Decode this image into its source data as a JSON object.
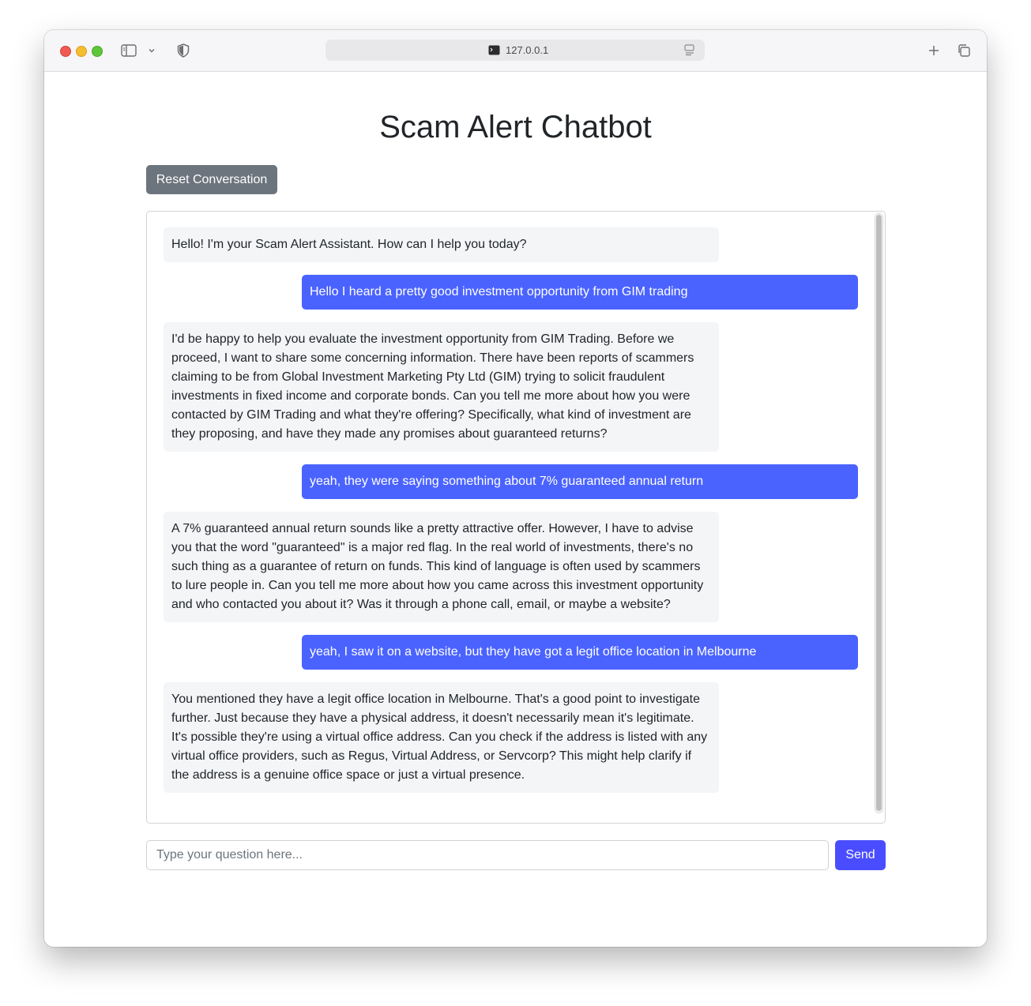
{
  "browser": {
    "url": "127.0.0.1"
  },
  "page": {
    "title": "Scam Alert Chatbot",
    "reset_label": "Reset Conversation",
    "messages": [
      {
        "role": "bot",
        "text": "Hello! I'm your Scam Alert Assistant. How can I help you today?"
      },
      {
        "role": "user",
        "text": "Hello I heard a pretty good investment opportunity from GIM trading"
      },
      {
        "role": "bot",
        "text": "I'd be happy to help you evaluate the investment opportunity from GIM Trading. Before we proceed, I want to share some concerning information. There have been reports of scammers claiming to be from Global Investment Marketing Pty Ltd (GIM) trying to solicit fraudulent investments in fixed income and corporate bonds. Can you tell me more about how you were contacted by GIM Trading and what they're offering? Specifically, what kind of investment are they proposing, and have they made any promises about guaranteed returns?"
      },
      {
        "role": "user",
        "text": "yeah, they were saying something about 7% guaranteed annual return"
      },
      {
        "role": "bot",
        "text": "A 7% guaranteed annual return sounds like a pretty attractive offer. However, I have to advise you that the word \"guaranteed\" is a major red flag. In the real world of investments, there's no such thing as a guarantee of return on funds. This kind of language is often used by scammers to lure people in. Can you tell me more about how you came across this investment opportunity and who contacted you about it? Was it through a phone call, email, or maybe a website?"
      },
      {
        "role": "user",
        "text": "yeah, I saw it on a website, but they have got a legit office location in Melbourne"
      },
      {
        "role": "bot",
        "text": "You mentioned they have a legit office location in Melbourne. That's a good point to investigate further. Just because they have a physical address, it doesn't necessarily mean it's legitimate. It's possible they're using a virtual office address. Can you check if the address is listed with any virtual office providers, such as Regus, Virtual Address, or Servcorp? This might help clarify if the address is a genuine office space or just a virtual presence."
      }
    ],
    "input": {
      "placeholder": "Type your question here...",
      "value": ""
    },
    "send_label": "Send"
  },
  "colors": {
    "user_bubble": "#4a63ff",
    "bot_bubble": "#f4f5f7",
    "send_button": "#4a4dff",
    "reset_button": "#6c757d"
  }
}
